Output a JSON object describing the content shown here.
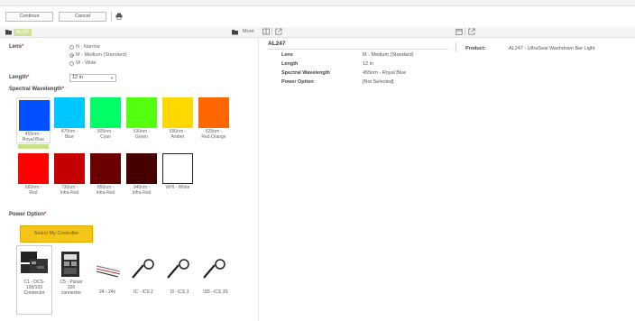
{
  "toolbar": {
    "continue_label": "Continue",
    "cancel_label": "Cancel",
    "print_icon": "printer-icon"
  },
  "header": {
    "tab_label": "AL247",
    "more_label": "More"
  },
  "lens": {
    "label": "Lens",
    "options": [
      "N - Narrow",
      "M - Medium (Standard)",
      "W - Wide"
    ],
    "selected": "M - Medium (Standard)"
  },
  "length": {
    "label": "Length",
    "value": "12 in"
  },
  "spectral": {
    "label": "Spectral Wavelength",
    "swatches": [
      {
        "caption": "455nm -\nRoyal Blue",
        "color": "#0050ff",
        "selected": true
      },
      {
        "caption": "470nm -\nBlue",
        "color": "#00c8ff"
      },
      {
        "caption": "505nm -\nCyan",
        "color": "#00ff66"
      },
      {
        "caption": "530nm -\nGreen",
        "color": "#55ff10"
      },
      {
        "caption": "590nm -\nAmber",
        "color": "#ffd800"
      },
      {
        "caption": "625nm -\nRed Orange",
        "color": "#ff6600"
      },
      {
        "caption": "660nm -\nRed",
        "color": "#ff0000"
      },
      {
        "caption": "730nm -\nInfra-Red",
        "color": "#c40000"
      },
      {
        "caption": "850nm -\nInfra-Red",
        "color": "#6a0000"
      },
      {
        "caption": "940nm -\nInfra-Red",
        "color": "#460000"
      },
      {
        "caption": "WHI - White",
        "color": "#ffffff"
      }
    ]
  },
  "power": {
    "label": "Power Option",
    "controller_button": "Select My Controller",
    "options": [
      {
        "caption": "C1 - DCS-\n100/103\nConnector",
        "icon": "dcs-controller-icon"
      },
      {
        "caption": "C5 - Pulsar\n320\nconnector",
        "icon": "pulsar-controller-icon"
      },
      {
        "caption": "24 - 24v",
        "icon": "wire-leads-icon"
      },
      {
        "caption": "IC - iCS 2",
        "icon": "ics-cable-icon"
      },
      {
        "caption": "I3 - iCS 3",
        "icon": "ics-cable-icon"
      },
      {
        "caption": "IS5 - iCS 3S",
        "icon": "ics-cable-icon"
      }
    ]
  },
  "summary": {
    "title": "AL247",
    "rows": [
      {
        "key": "Lens",
        "value": "M - Medium (Standard)"
      },
      {
        "key": "Length",
        "value": "12 in"
      },
      {
        "key": "Spectral Wavelength",
        "value": "455nm - Royal Blue"
      },
      {
        "key": "Power Option",
        "value": "[Not Selected]"
      }
    ]
  },
  "product": {
    "label": "Product:",
    "value": "AL247 - UltraSeal Washdown Bar Light"
  }
}
